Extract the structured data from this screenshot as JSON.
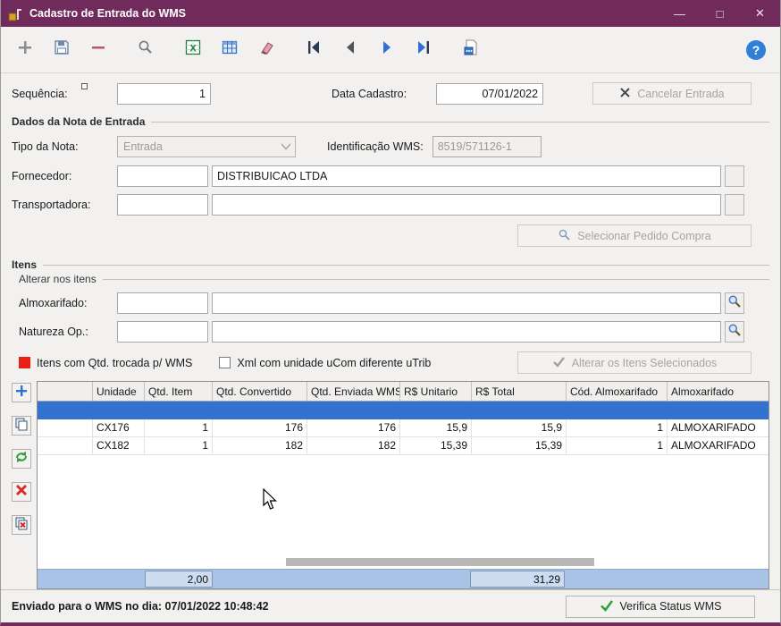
{
  "window": {
    "title": "Cadastro de Entrada do WMS",
    "controls": {
      "minimize": "—",
      "maximize": "□",
      "close": "✕"
    }
  },
  "toolbar": {
    "help_glyph": "?"
  },
  "header_fields": {
    "sequencia_label": "Sequência:",
    "sequencia_value": "1",
    "data_cadastro_label": "Data Cadastro:",
    "data_cadastro_value": "07/01/2022",
    "cancelar_button": "Cancelar Entrada"
  },
  "nota": {
    "title": "Dados da Nota de Entrada",
    "tipo_label": "Tipo da Nota:",
    "tipo_value": "Entrada",
    "identificacao_label": "Identificação WMS:",
    "identificacao_value": "8519/571126-1",
    "fornecedor_label": "Fornecedor:",
    "fornecedor_codigo": "",
    "fornecedor_nome": "DISTRIBUICAO LTDA",
    "transportadora_label": "Transportadora:",
    "transportadora_codigo": "",
    "transportadora_nome": "",
    "selecionar_pedido_button": "Selecionar Pedido Compra"
  },
  "itens": {
    "title": "Itens",
    "alterar_title": "Alterar nos itens",
    "almoxarifado_label": "Almoxarifado:",
    "almoxarifado_codigo": "",
    "almoxarifado_descricao": "",
    "natureza_label": "Natureza Op.:",
    "natureza_codigo": "",
    "natureza_descricao": "",
    "legend_text": "Itens com Qtd. trocada p/ WMS",
    "checkbox_text": "Xml com unidade uCom diferente uTrib",
    "alterar_button": "Alterar os Itens Selecionados"
  },
  "grid": {
    "headers": [
      "",
      "Unidade",
      "Qtd. Item",
      "Qtd. Convertido",
      "Qtd. Enviada WMS",
      "R$ Unitario",
      "R$ Total",
      "Cód. Almoxarifado",
      "Almoxarifado"
    ],
    "rows": [
      [
        "",
        "CX176",
        "1",
        "176",
        "176",
        "15,9",
        "15,9",
        "1",
        "ALMOXARIFADO"
      ],
      [
        "",
        "CX182",
        "1",
        "182",
        "182",
        "15,39",
        "15,39",
        "1",
        "ALMOXARIFADO"
      ]
    ],
    "totals": {
      "qtd_item": "2,00",
      "valor_total": "31,29"
    }
  },
  "statusbar": {
    "message": "Enviado para o WMS no dia: 07/01/2022 10:48:42",
    "verifica_button": "Verifica Status WMS"
  },
  "colors": {
    "titlebar": "#702b5c",
    "selection_blue": "#3273d0",
    "totals_bg": "#a9c3e6",
    "legend_red": "#e81f17",
    "status_green": "#2ea335"
  },
  "icons": {
    "toolbar": [
      "add-icon",
      "save-icon",
      "remove-icon",
      "search-icon",
      "excel-export-icon",
      "grid-view-icon",
      "eraser-icon",
      "nav-first-icon",
      "nav-prev-icon",
      "nav-next-icon",
      "nav-last-icon",
      "log-icon",
      "help-icon"
    ],
    "grid_side": [
      "add-row-icon",
      "duplicate-row-icon",
      "refresh-rows-icon",
      "delete-row-icon",
      "delete-all-rows-icon"
    ]
  }
}
